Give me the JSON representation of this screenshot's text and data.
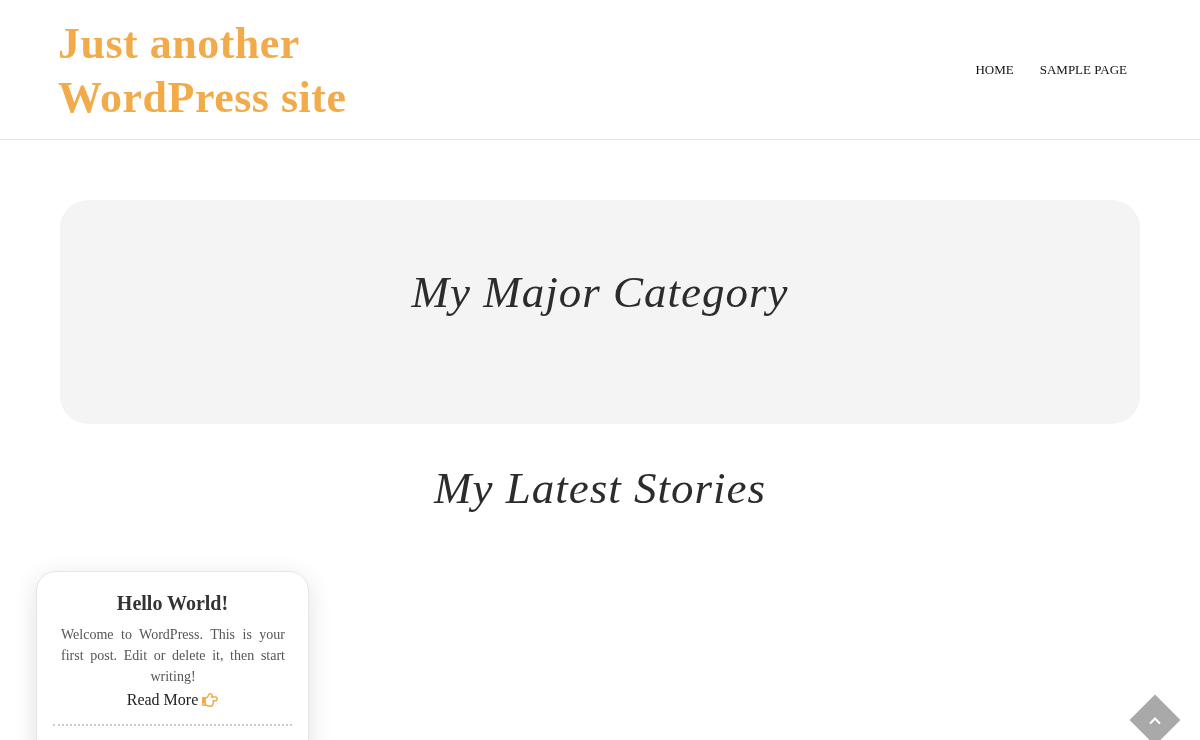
{
  "header": {
    "site_title": "Just another WordPress site",
    "nav": [
      {
        "label": "HOME"
      },
      {
        "label": "SAMPLE PAGE"
      }
    ]
  },
  "category_banner": {
    "title": "My Major Category"
  },
  "section_title": "My Latest Stories",
  "posts": [
    {
      "title": "Hello World!",
      "excerpt": "Welcome to WordPress. This is your first post. Edit or delete it, then start writing!",
      "read_more": "Read More"
    }
  ]
}
